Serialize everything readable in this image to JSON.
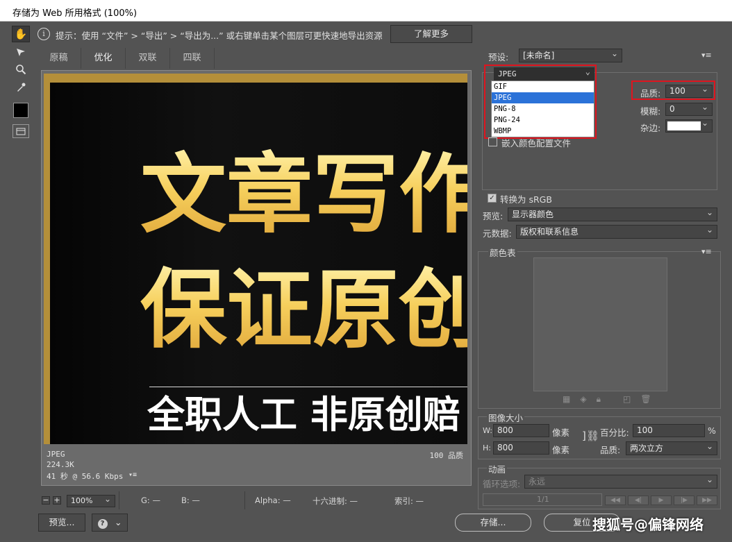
{
  "window": {
    "title": "存储为 Web 所用格式 (100%)"
  },
  "tools": [
    "hand-tool-icon",
    "slice-select-icon",
    "zoom-icon",
    "eyedropper-icon",
    "eyedropper-color-swatch",
    "toggle-slices-icon"
  ],
  "hint": {
    "icon": "i",
    "text": "提示：使用 “文件” > “导出” > “导出为...” 或右键单击某个图层可更快速地导出资源",
    "learn_more": "了解更多"
  },
  "tabs": [
    "原稿",
    "优化",
    "双联",
    "四联"
  ],
  "active_tab": "优化",
  "preview_image": {
    "line1": "文章写作",
    "line2": "保证原创",
    "line3": "全职人工 非原创赔"
  },
  "canvas_info": {
    "format": "JPEG",
    "size": "224.3K",
    "time": "41 秒 @ 56.6 Kbps",
    "quality": "100 品质",
    "menu": "▾≡"
  },
  "status": {
    "zoom": "100%",
    "g": "G: —",
    "b": "B: —",
    "alpha": "Alpha: —",
    "hex": "十六进制: —",
    "index": "索引: —"
  },
  "bottom_buttons": {
    "preview": "预览...",
    "browser": "?",
    "save": "存储...",
    "reset": "复位"
  },
  "settings": {
    "preset_label": "预设:",
    "preset_value": "[未命名]",
    "format_value": "JPEG",
    "format_options": [
      "GIF",
      "JPEG",
      "PNG-8",
      "PNG-24",
      "WBMP"
    ],
    "format_selected": "JPEG",
    "quality_label": "品质:",
    "quality_value": "100",
    "blur_label": "模糊:",
    "blur_value": "0",
    "matte_label": "杂边:",
    "matte_color": "#ffffff",
    "embed_profile": "嵌入颜色配置文件",
    "convert_srgb": "转换为 sRGB",
    "preview_label": "预览:",
    "preview_value": "显示器颜色",
    "metadata_label": "元数据:",
    "metadata_value": "版权和联系信息"
  },
  "color_table": {
    "title": "颜色表"
  },
  "image_size": {
    "title": "图像大小",
    "w_label": "W:",
    "w_value": "800",
    "h_label": "H:",
    "h_value": "800",
    "unit": "像素",
    "percent_label": "百分比:",
    "percent_value": "100",
    "percent_unit": "%",
    "quality_label": "品质:",
    "quality_value": "两次立方"
  },
  "animation": {
    "title": "动画",
    "loop_label": "循环选项:",
    "loop_value": "永远",
    "frame": "1/1"
  },
  "watermark": "搜狐号@偏锋网络"
}
